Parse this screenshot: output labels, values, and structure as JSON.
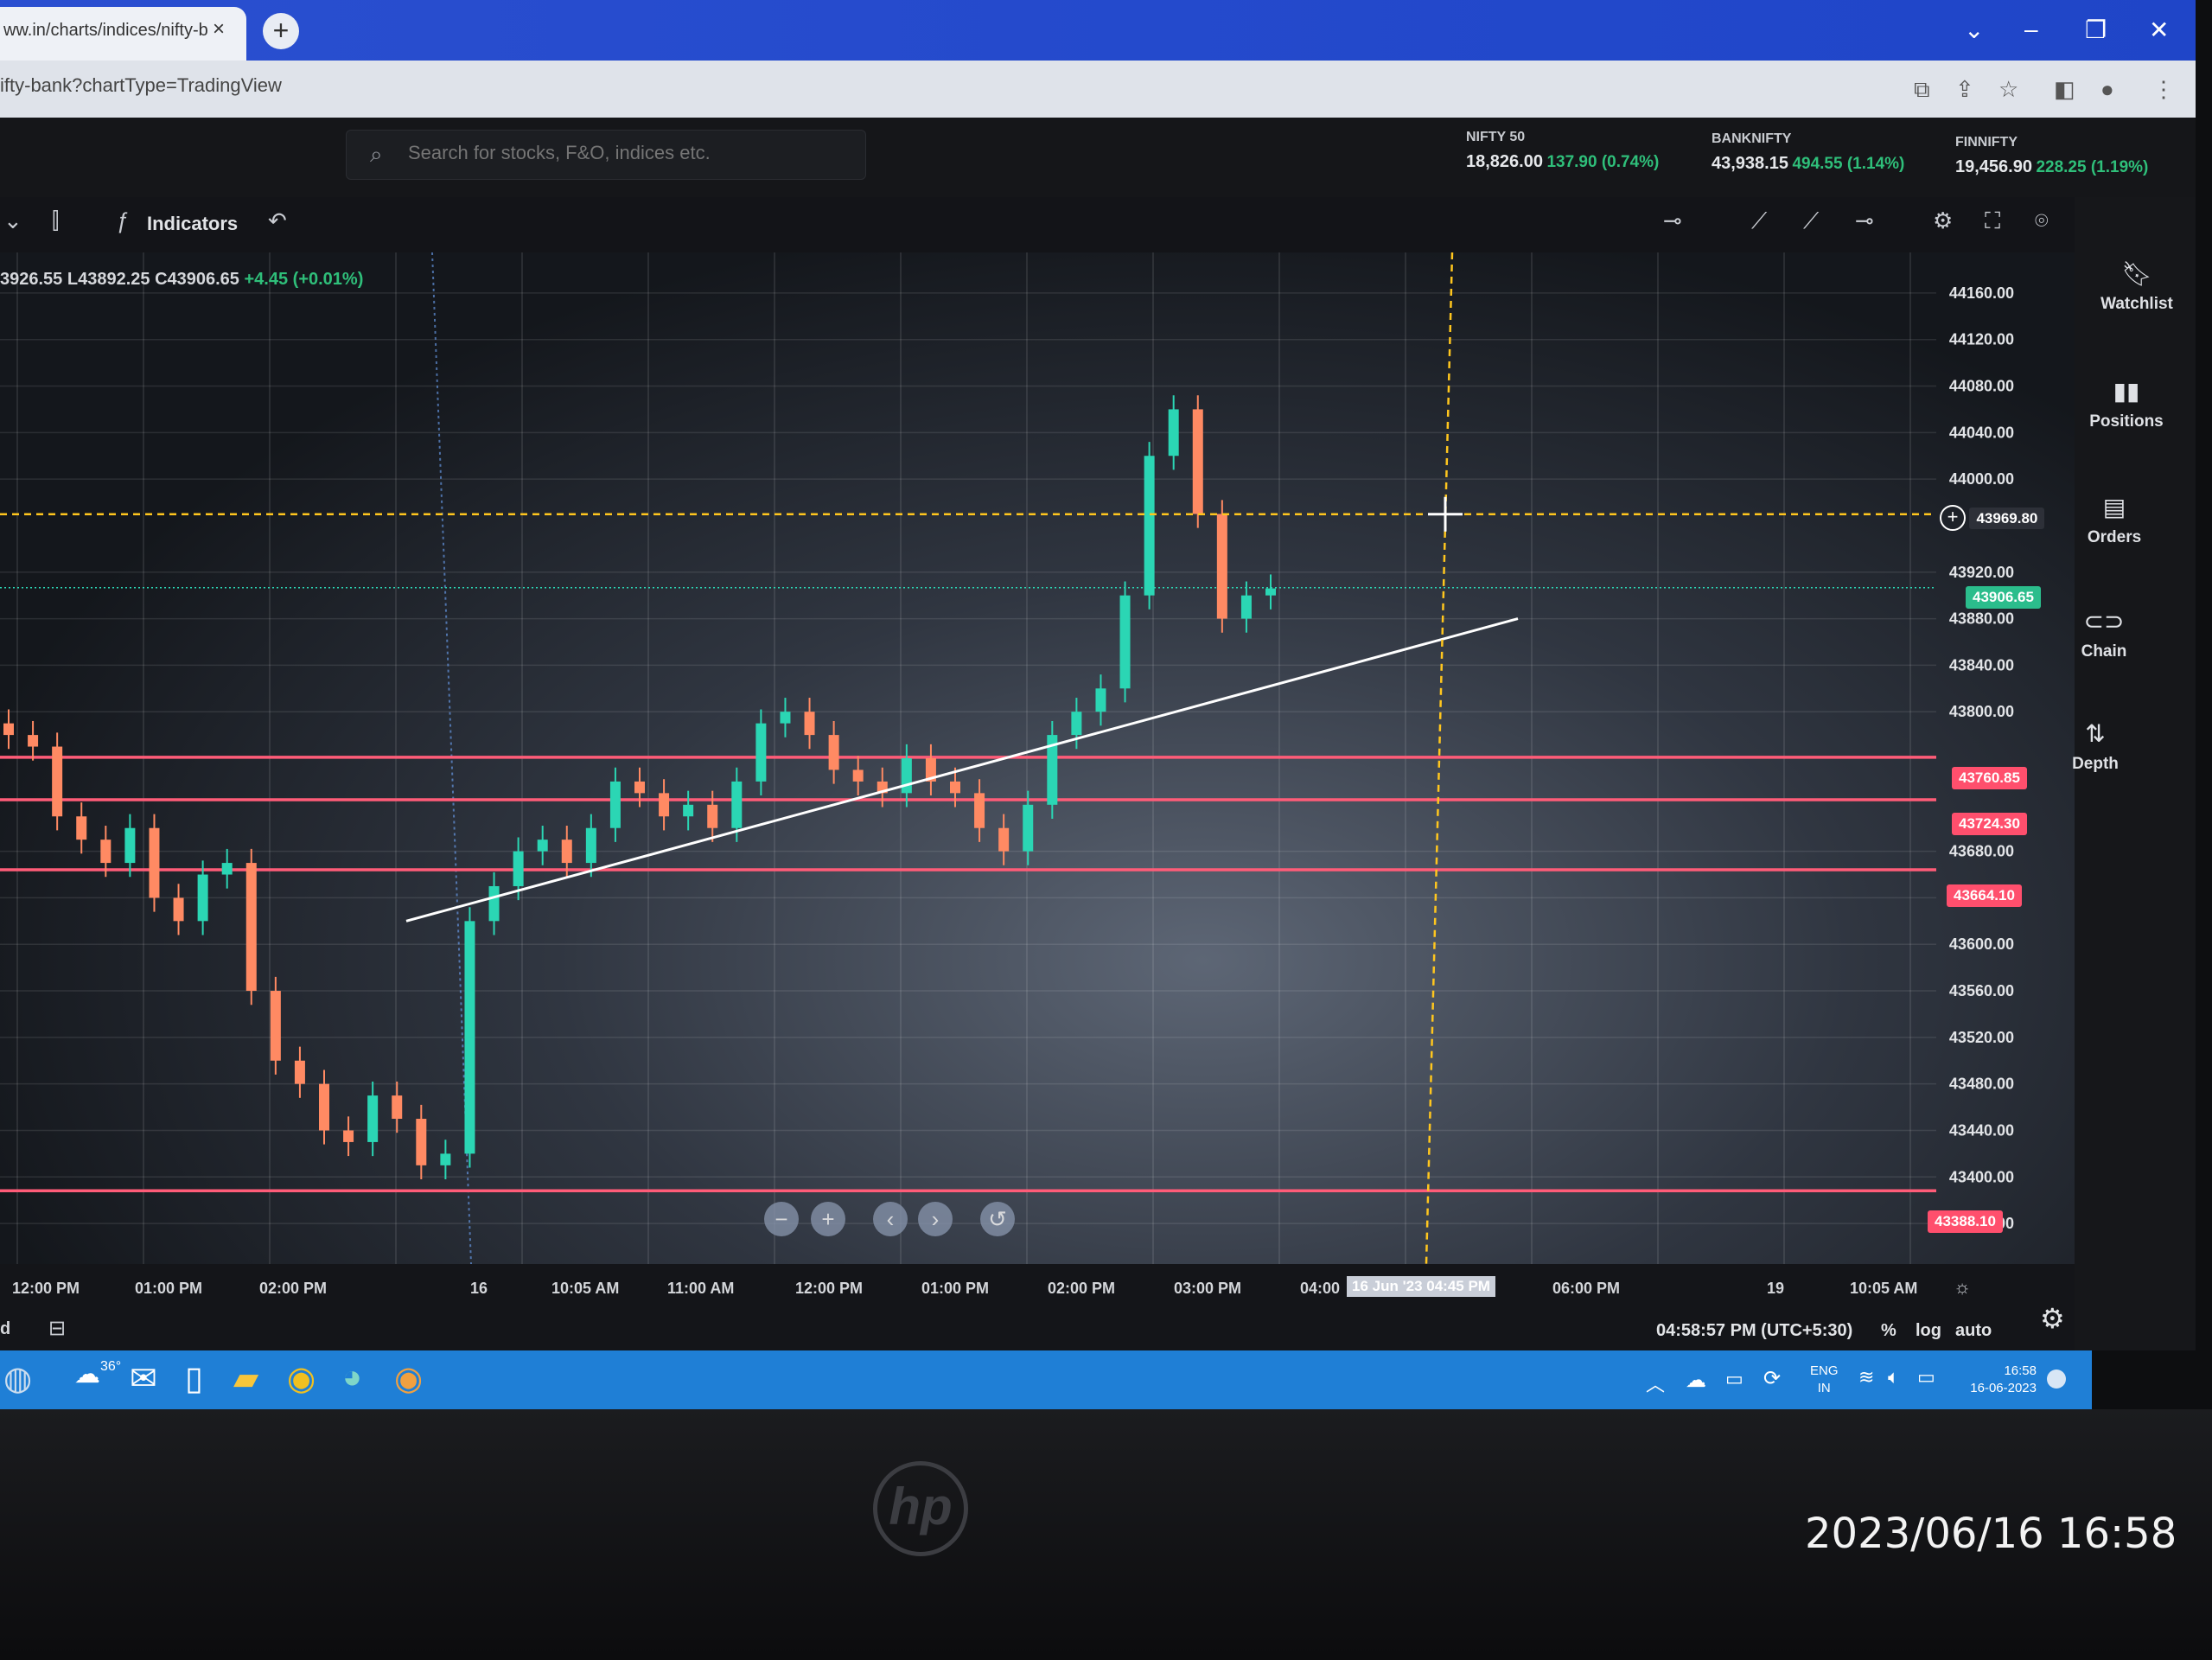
{
  "browser": {
    "tab_title": "ww.in/charts/indices/nifty-b",
    "tab_close": "×",
    "new_tab": "+",
    "url": "ifty-bank?chartType=TradingView"
  },
  "header": {
    "search_placeholder": "Search for stocks, F&O, indices etc.",
    "tickers": [
      {
        "name": "NIFTY 50",
        "value": "18,826.00",
        "change": "137.90 (0.74%)"
      },
      {
        "name": "BANKNIFTY",
        "value": "43,938.15",
        "change": "494.55 (1.14%)"
      },
      {
        "name": "FINNIFTY",
        "value": "19,456.90",
        "change": "228.25 (1.19%)"
      }
    ]
  },
  "toolbar": {
    "indicators_label": "Indicators"
  },
  "legend": {
    "high": "3926.55",
    "low": "L43892.25",
    "close": "C43906.65",
    "change": "+4.45 (+0.01%)"
  },
  "sidebar": {
    "items": [
      {
        "label": "Watchlist",
        "icon": "bookmark-icon"
      },
      {
        "label": "Positions",
        "icon": "bar-chart-icon"
      },
      {
        "label": "Orders",
        "icon": "document-icon"
      },
      {
        "label": "Chain",
        "icon": "link-icon"
      },
      {
        "label": "Depth",
        "icon": "sort-arrows-icon"
      }
    ]
  },
  "price_badges": {
    "crosshair": "43969.80",
    "last": "43906.65",
    "h1": "43760.85",
    "h2": "43724.30",
    "h3": "43664.10",
    "h4": "43388.10"
  },
  "x_ticks": [
    "12:00 PM",
    "01:00 PM",
    "02:00 PM",
    "16",
    "10:05 AM",
    "11:00 AM",
    "12:00 PM",
    "01:00 PM",
    "02:00 PM",
    "03:00 PM",
    "04:00",
    "06:00 PM",
    "19",
    "10:05 AM"
  ],
  "x_crosshair_label": "16 Jun '23   04:45 PM",
  "status": {
    "time": "04:58:57 PM (UTC+5:30)",
    "percent": "%",
    "log": "log",
    "auto": "auto",
    "left_label": "d"
  },
  "taskbar": {
    "weather": "36°",
    "lang1": "ENG",
    "lang2": "IN",
    "clock": "16:58",
    "date": "16-06-2023"
  },
  "photo_timestamp": "2023/06/16 16:58",
  "chart_data": {
    "type": "candlestick",
    "title": "BANKNIFTY",
    "x_labels": [
      "12:00 PM",
      "01:00 PM",
      "02:00 PM",
      "16",
      "10:05 AM",
      "11:00 AM",
      "12:00 PM",
      "01:00 PM",
      "02:00 PM",
      "03:00 PM",
      "04:00",
      "06:00 PM",
      "19",
      "10:05 AM"
    ],
    "y_ticks": [
      44160,
      44120,
      44080,
      44040,
      44000,
      43920,
      43880,
      43840,
      43800,
      43680,
      43640,
      43600,
      43560,
      43520,
      43480,
      43440,
      43400,
      43360
    ],
    "ylim": [
      43340,
      44180
    ],
    "horizontal_levels": [
      43760.85,
      43724.3,
      43664.1,
      43388.1
    ],
    "crosshair_price": 43969.8,
    "last_price": 43906.65,
    "close_path": [
      43780,
      43770,
      43710,
      43690,
      43670,
      43700,
      43640,
      43620,
      43660,
      43670,
      43560,
      43500,
      43480,
      43440,
      43430,
      43470,
      43450,
      43410,
      43420,
      43620,
      43650,
      43680,
      43690,
      43670,
      43700,
      43740,
      43730,
      43710,
      43720,
      43700,
      43740,
      43790,
      43800,
      43780,
      43750,
      43740,
      43730,
      43760,
      43740,
      43730,
      43700,
      43680,
      43720,
      43780,
      43800,
      43820,
      43900,
      44020,
      44060,
      43970,
      43880,
      43900,
      43906
    ],
    "trendline": [
      [
        43620,
        0
      ],
      [
        43880,
        1
      ]
    ]
  },
  "colors": {
    "up": "#2bd6b4",
    "down": "#ff8a63",
    "level": "#ff5c78",
    "crosshair": "#ffc61e",
    "taskbar": "#1f7fd6"
  }
}
